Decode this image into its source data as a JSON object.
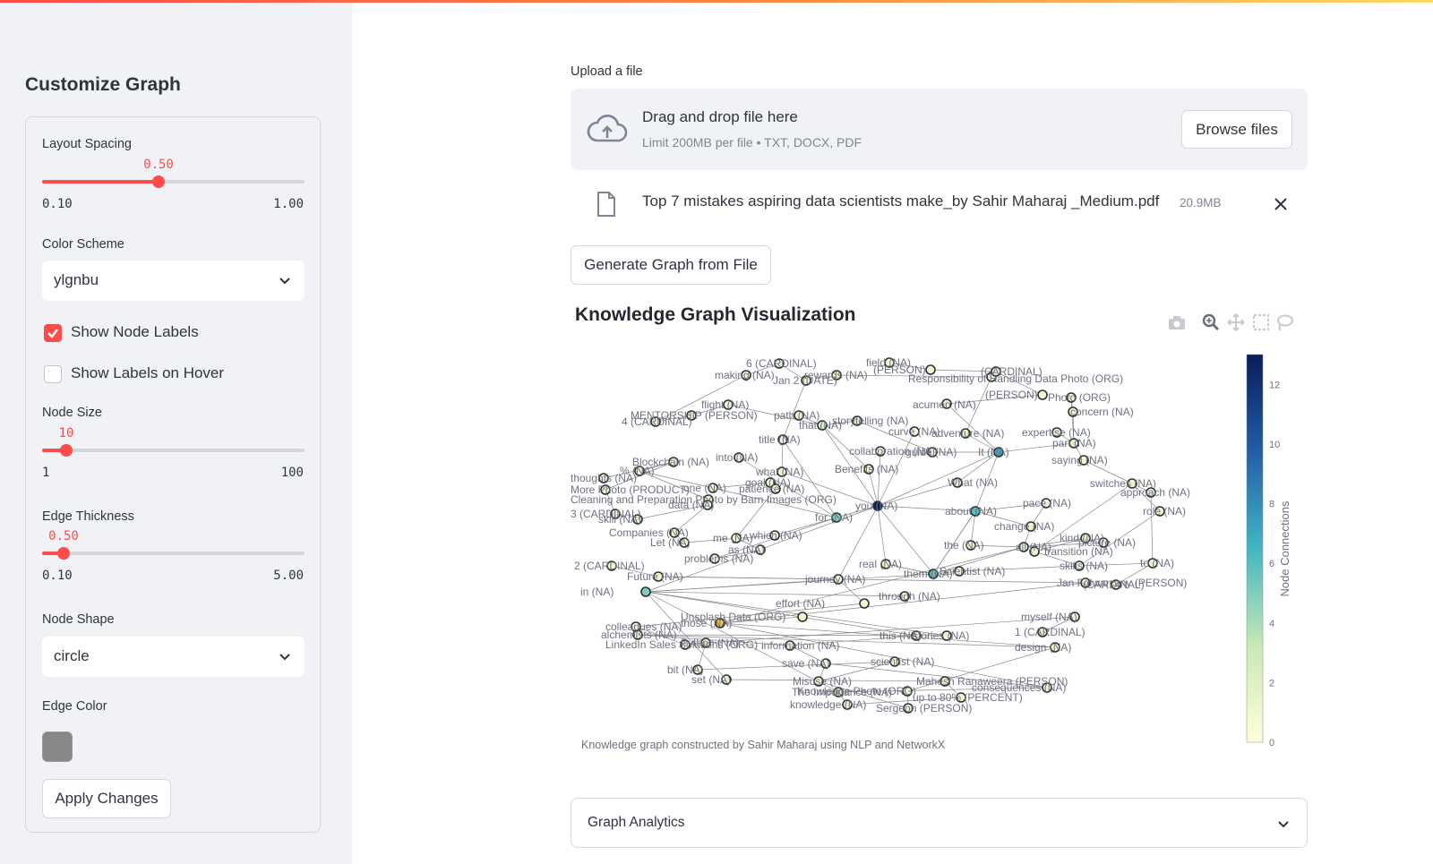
{
  "sidebar": {
    "title": "Customize Graph",
    "layout_spacing": {
      "label": "Layout Spacing",
      "value": "0.50",
      "min": "0.10",
      "max": "1.00",
      "fraction": 0.444
    },
    "color_scheme": {
      "label": "Color Scheme",
      "value": "ylgnbu"
    },
    "show_node_labels": {
      "label": "Show Node Labels",
      "checked": true
    },
    "show_labels_on_hover": {
      "label": "Show Labels on Hover",
      "checked": false
    },
    "node_size": {
      "label": "Node Size",
      "value": "10",
      "min": "1",
      "max": "100",
      "fraction": 0.091
    },
    "edge_thickness": {
      "label": "Edge Thickness",
      "value": "0.50",
      "min": "0.10",
      "max": "5.00",
      "fraction": 0.082
    },
    "node_shape": {
      "label": "Node Shape",
      "value": "circle"
    },
    "edge_color": {
      "label": "Edge Color",
      "value": "#888888"
    },
    "apply_button": "Apply Changes"
  },
  "main": {
    "upload_label": "Upload a file",
    "drop_title": "Drag and drop file here",
    "drop_sub": "Limit 200MB per file • TXT, DOCX, PDF",
    "browse_button": "Browse files",
    "file_name": "Top 7 mistakes aspiring data scientists make_by Sahir Maharaj _Medium.pdf",
    "file_size": "20.9MB",
    "generate_button": "Generate Graph from File",
    "chart_title": "Knowledge Graph Visualization",
    "expander_label": "Graph Analytics"
  },
  "colors": {
    "accent": "#ff4b4b",
    "sidebar_bg": "#f0f2f6",
    "edge": "#888888",
    "label": "#6e7180"
  },
  "toolbar_icons": [
    "camera-icon",
    "zoom-icon",
    "pan-icon",
    "box-select-icon",
    "lasso-icon"
  ],
  "chart_data": {
    "type": "network",
    "title": "Knowledge Graph Visualization",
    "caption": "Knowledge graph constructed by Sahir Maharaj using NLP and NetworkX",
    "colorbar": {
      "title": "Node Connections",
      "colorscale": "ylgnbu",
      "ticks": [
        0,
        2,
        4,
        6,
        8,
        10,
        12
      ],
      "min": 0,
      "max": 13
    },
    "nodes": [
      {
        "label": "6 (CARDINAL)",
        "c": 1
      },
      {
        "label": "making (NA)",
        "c": 1
      },
      {
        "label": "rewards (NA)",
        "c": 1
      },
      {
        "label": "Jan 2 (DATE)",
        "c": 1
      },
      {
        "label": "Responsibility of Handling Data Photo (ORG)",
        "c": 1
      },
      {
        "label": "field (NA)",
        "c": 1
      },
      {
        "label": "(PERSON)",
        "c": 1
      },
      {
        "label": "(CARDINAL)",
        "c": 1
      },
      {
        "label": "acumen (NA)",
        "c": 1
      },
      {
        "label": "(PERSON)",
        "c": 1
      },
      {
        "label": "Photo (ORG)",
        "c": 1
      },
      {
        "label": "concern (NA)",
        "c": 1
      },
      {
        "label": "flight (NA)",
        "c": 1
      },
      {
        "label": "4 (CARDINAL)",
        "c": 1
      },
      {
        "label": "MENTORSHIP (PERSON)",
        "c": 1
      },
      {
        "label": "path (NA)",
        "c": 1
      },
      {
        "label": "that (NA)",
        "c": 2
      },
      {
        "label": "storytelling (NA)",
        "c": 2
      },
      {
        "label": "curve (NA)",
        "c": 1
      },
      {
        "label": "adventure (NA)",
        "c": 1
      },
      {
        "label": "expertise (NA)",
        "c": 1
      },
      {
        "label": "part (NA)",
        "c": 2
      },
      {
        "label": "title (NA)",
        "c": 1
      },
      {
        "label": "collaboration (NA)",
        "c": 1
      },
      {
        "label": "guide (NA)",
        "c": 1
      },
      {
        "label": "It (NA)",
        "c": 7
      },
      {
        "label": "saying (NA)",
        "c": 1
      },
      {
        "label": "Blockchain (NA)",
        "c": 1
      },
      {
        "label": "into (NA)",
        "c": 1
      },
      {
        "label": "Benefits (NA)",
        "c": 1
      },
      {
        "label": "what (NA)",
        "c": 1
      },
      {
        "label": "thoughts (NA)",
        "c": 1
      },
      {
        "label": "% (NA)",
        "c": 1
      },
      {
        "label": "goal (NA)",
        "c": 1
      },
      {
        "label": "patience (NA)",
        "c": 1
      },
      {
        "label": "What (NA)",
        "c": 1
      },
      {
        "label": "switches (NA)",
        "c": 1
      },
      {
        "label": "approach (NA)",
        "c": 1
      },
      {
        "label": "More Photo (PRODUCT)",
        "c": 1
      },
      {
        "label": "one (NA)",
        "c": 1
      },
      {
        "label": "Cleaning and Preparation Photo by Barn Images (ORG)",
        "c": 1
      },
      {
        "label": "you (NA)",
        "c": 13
      },
      {
        "label": "about (NA)",
        "c": 6
      },
      {
        "label": "pace (NA)",
        "c": 1
      },
      {
        "label": "role (NA)",
        "c": 1
      },
      {
        "label": "3 (CARDINAL)",
        "c": 1
      },
      {
        "label": "skill (NA)",
        "c": 1
      },
      {
        "label": "data (NA)",
        "c": 1
      },
      {
        "label": "for (NA)",
        "c": 5
      },
      {
        "label": "change (NA)",
        "c": 1
      },
      {
        "label": "Companies (NA)",
        "c": 1
      },
      {
        "label": "Let (NA)",
        "c": 1
      },
      {
        "label": "me (NA)",
        "c": 1
      },
      {
        "label": "which (NA)",
        "c": 1
      },
      {
        "label": "kind (NA)",
        "c": 1
      },
      {
        "label": "picture (NA)",
        "c": 1
      },
      {
        "label": "as (NA)",
        "c": 1
      },
      {
        "label": "the (NA)",
        "c": 1
      },
      {
        "label": "all (NA)",
        "c": 1
      },
      {
        "label": "transition (NA)",
        "c": 1
      },
      {
        "label": "problems (NA)",
        "c": 1
      },
      {
        "label": "to (NA)",
        "c": 1
      },
      {
        "label": "2 (CARDINAL)",
        "c": 1
      },
      {
        "label": "real (NA)",
        "c": 1
      },
      {
        "label": "skills (NA)",
        "c": 1
      },
      {
        "label": "Future (NA)",
        "c": 1
      },
      {
        "label": "journey (NA)",
        "c": 1
      },
      {
        "label": "them (NA)",
        "c": 6
      },
      {
        "label": "Scientist (NA)",
        "c": 1
      },
      {
        "label": "(CARDINAL)",
        "c": 1
      },
      {
        "label": "Jan Folwarczny (PERSON)",
        "c": 1
      },
      {
        "label": "in (NA)",
        "c": 5
      },
      {
        "label": "through (NA)",
        "c": 1
      },
      {
        "label": "effort (NA)",
        "c": 1
      },
      {
        "label": "Unsplash Data (ORG)",
        "c": 1
      },
      {
        "label": "myself (NA)",
        "c": 1
      },
      {
        "label": "colleagues (NA)",
        "c": 1
      },
      {
        "label": "those (NA)",
        "c": 4
      },
      {
        "label": "1 (CARDINAL)",
        "c": 1
      },
      {
        "label": "alchemists (NA)",
        "c": 1
      },
      {
        "label": "this (NA)",
        "c": 1
      },
      {
        "label": "stories (NA)",
        "c": 1
      },
      {
        "label": "design (NA)",
        "c": 1
      },
      {
        "label": "LinkedIn Sales Solutions (ORG)",
        "c": 1
      },
      {
        "label": "Python (NA)",
        "c": 1
      },
      {
        "label": "information (NA)",
        "c": 1
      },
      {
        "label": "save (NA)",
        "c": 1
      },
      {
        "label": "scientist (NA)",
        "c": 1
      },
      {
        "label": "bit (NA)",
        "c": 1
      },
      {
        "label": "set (NA)",
        "c": 1
      },
      {
        "label": "Misuse (NA)",
        "c": 1
      },
      {
        "label": "Mahesh Ranaweera (PERSON)",
        "c": 1
      },
      {
        "label": "consequences (NA)",
        "c": 1
      },
      {
        "label": "The Importance (NA)",
        "c": 1
      },
      {
        "label": "Knowledge Photo (ORG)",
        "c": 1
      },
      {
        "label": "up to 80% (PERCENT)",
        "c": 1
      },
      {
        "label": "knowledge (NA)",
        "c": 1
      },
      {
        "label": "Sergeon (PERSON)",
        "c": 1
      }
    ]
  }
}
